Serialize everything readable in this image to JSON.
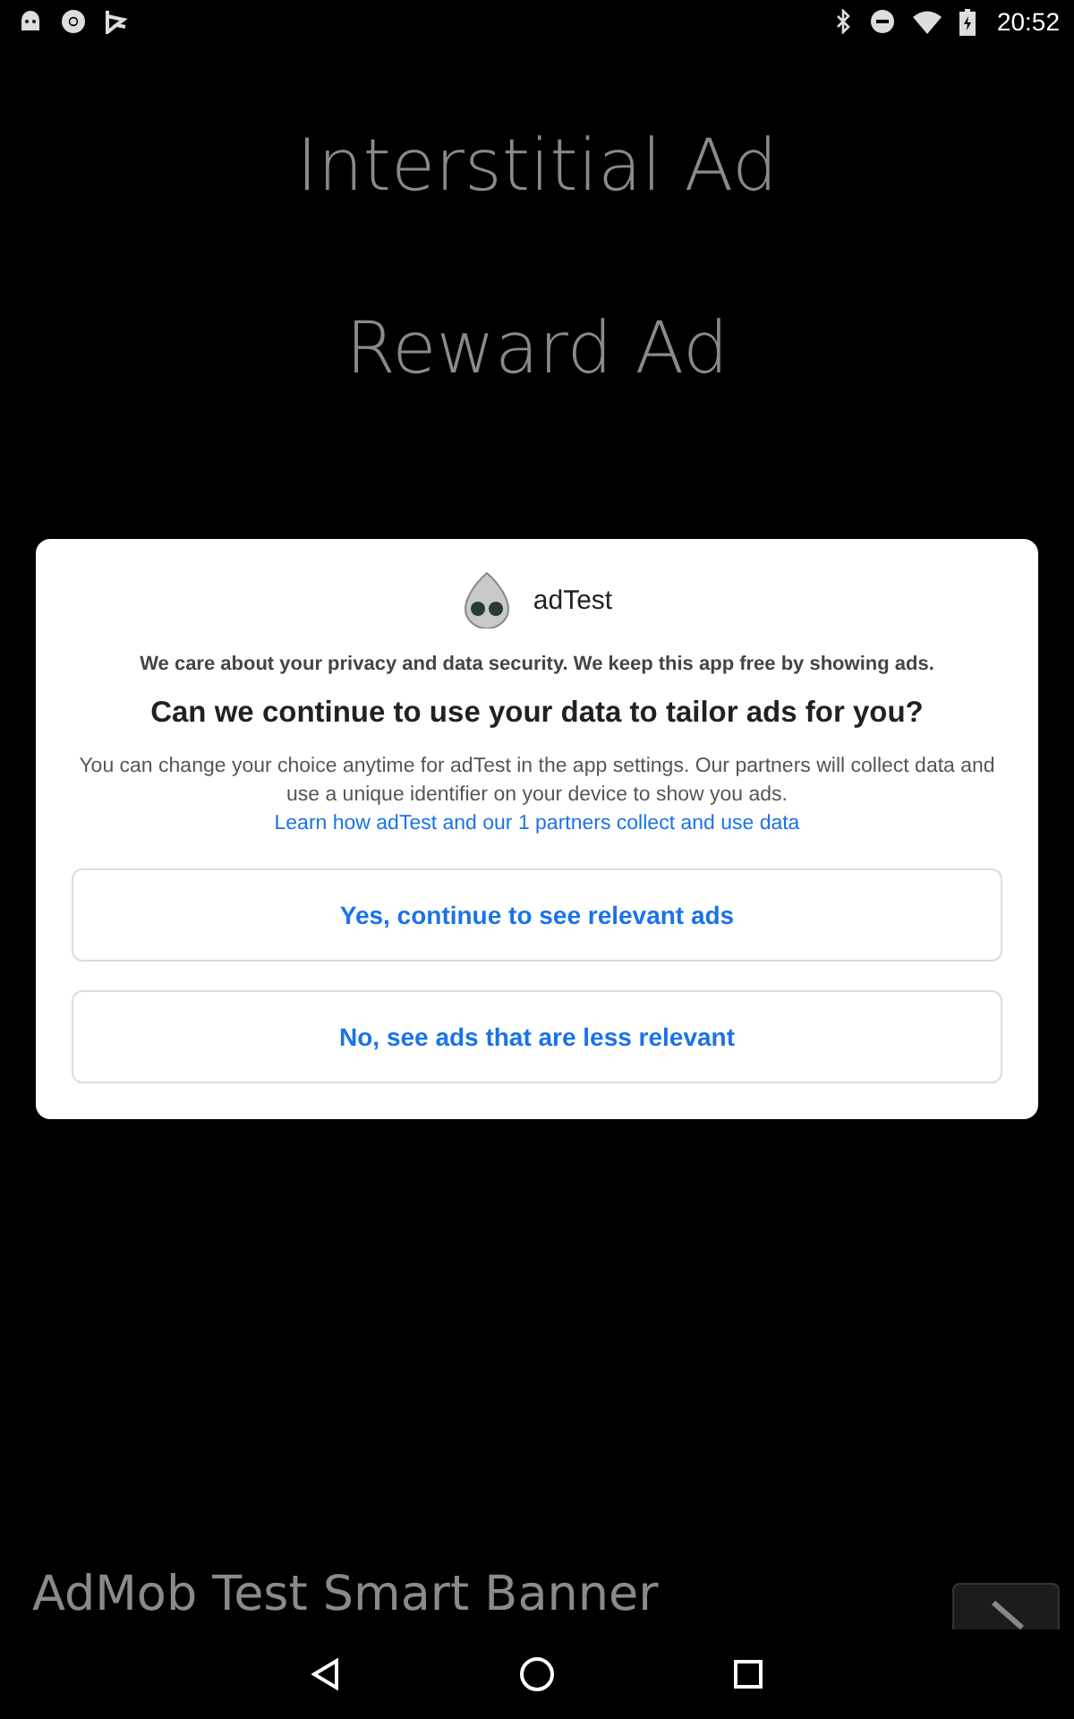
{
  "status_bar": {
    "time": "20:52"
  },
  "background": {
    "buttons": [
      "Interstitial Ad",
      "Reward Ad"
    ],
    "banner": "AdMob Test Smart Banner"
  },
  "dialog": {
    "app_name": "adTest",
    "intro": "We care about your privacy and data security. We keep this app free by showing ads.",
    "question": "Can we continue to use your data to tailor ads for you?",
    "body": "You can change your choice anytime for adTest in the app settings. Our partners will collect data and use a unique identifier on your device to show you ads.",
    "link": "Learn how adTest and our 1 partners collect and use data",
    "options": [
      "Yes, continue to see relevant ads",
      "No, see ads that are less relevant"
    ]
  }
}
